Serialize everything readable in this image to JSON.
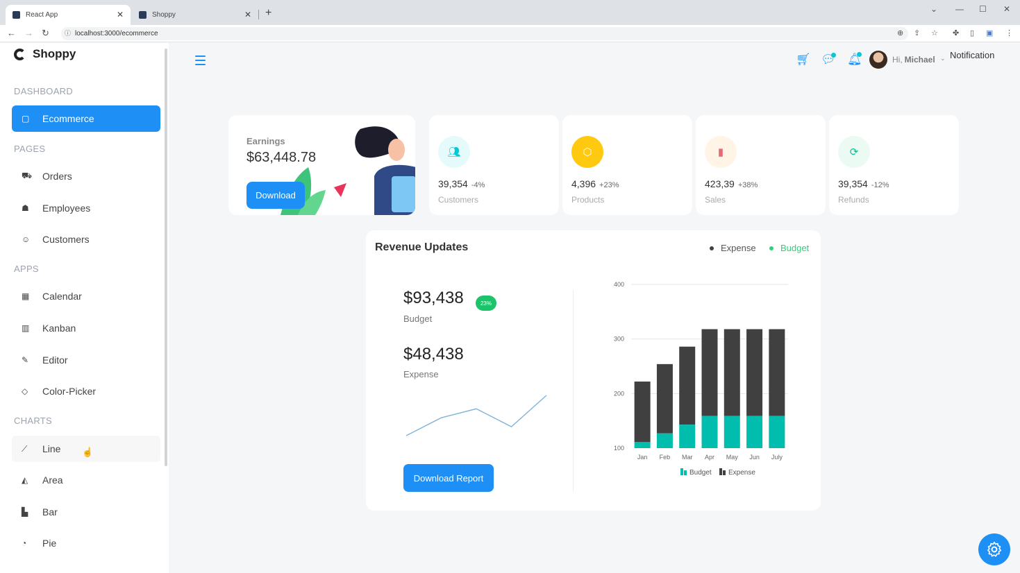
{
  "browser": {
    "tabs": [
      {
        "title": "React App",
        "active": true
      },
      {
        "title": "Shoppy",
        "active": false
      }
    ],
    "url": "localhost:3000/ecommerce"
  },
  "sidebar": {
    "brand": "Shoppy",
    "sections": [
      {
        "title": "DASHBOARD",
        "items": [
          {
            "label": "Ecommerce",
            "icon": "shopping-bag-icon",
            "active": true
          }
        ]
      },
      {
        "title": "PAGES",
        "items": [
          {
            "label": "Orders",
            "icon": "cart-icon"
          },
          {
            "label": "Employees",
            "icon": "employees-icon"
          },
          {
            "label": "Customers",
            "icon": "customers-icon"
          }
        ]
      },
      {
        "title": "APPS",
        "items": [
          {
            "label": "Calendar",
            "icon": "calendar-icon"
          },
          {
            "label": "Kanban",
            "icon": "kanban-icon"
          },
          {
            "label": "Editor",
            "icon": "editor-icon"
          },
          {
            "label": "Color-Picker",
            "icon": "color-picker-icon"
          }
        ]
      },
      {
        "title": "CHARTS",
        "items": [
          {
            "label": "Line",
            "icon": "line-chart-icon",
            "hover": true
          },
          {
            "label": "Area",
            "icon": "area-chart-icon"
          },
          {
            "label": "Bar",
            "icon": "bar-chart-icon"
          },
          {
            "label": "Pie",
            "icon": "pie-chart-icon"
          }
        ]
      }
    ]
  },
  "navbar": {
    "greeting": "Hi,",
    "user_name": "Michael",
    "notification_text": "Notification"
  },
  "earnings": {
    "label": "Earnings",
    "value": "$63,448.78",
    "button": "Download"
  },
  "stats": [
    {
      "value": "39,354",
      "change": "-4%",
      "label": "Customers",
      "icon": "customers-icon",
      "icon_color": "#03c9d7",
      "bg_color": "#e5fafb"
    },
    {
      "value": "4,396",
      "change": "+23%",
      "label": "Products",
      "icon": "box-icon",
      "icon_color": "#ffffff",
      "bg_color": "#fec90f"
    },
    {
      "value": "423,39",
      "change": "+38%",
      "label": "Sales",
      "icon": "bar-chart-icon",
      "icon_color": "#e46a76",
      "bg_color": "#fff4e5"
    },
    {
      "value": "39,354",
      "change": "-12%",
      "label": "Refunds",
      "icon": "refresh-icon",
      "icon_color": "#00c292",
      "bg_color": "#ebfaf2"
    }
  ],
  "revenue": {
    "title": "Revenue Updates",
    "legend_expense": "Expense",
    "legend_budget": "Budget",
    "budget_value": "$93,438",
    "budget_pct": "23%",
    "budget_label": "Budget",
    "expense_value": "$48,438",
    "expense_label": "Expense",
    "button": "Download Report"
  },
  "colors": {
    "accent": "#1e90f5",
    "budget": "#00bdae",
    "expense": "#404041",
    "badge_green": "#1cc36a"
  },
  "chart_data": {
    "type": "bar",
    "stacked": true,
    "categories": [
      "Jan",
      "Feb",
      "Mar",
      "Apr",
      "May",
      "Jun",
      "July"
    ],
    "series": [
      {
        "name": "Budget",
        "values": [
          111,
          127,
          143,
          159,
          159,
          159,
          159
        ],
        "color": "#00bdae"
      },
      {
        "name": "Expense",
        "values": [
          111,
          127,
          143,
          159,
          159,
          159,
          159
        ],
        "color": "#404041"
      }
    ],
    "ylim": [
      100,
      400
    ],
    "yticks": [
      100,
      200,
      300,
      400
    ],
    "legend_position": "bottom",
    "grid": true
  },
  "sparkline": {
    "values": [
      2,
      6,
      8,
      4,
      11
    ]
  }
}
